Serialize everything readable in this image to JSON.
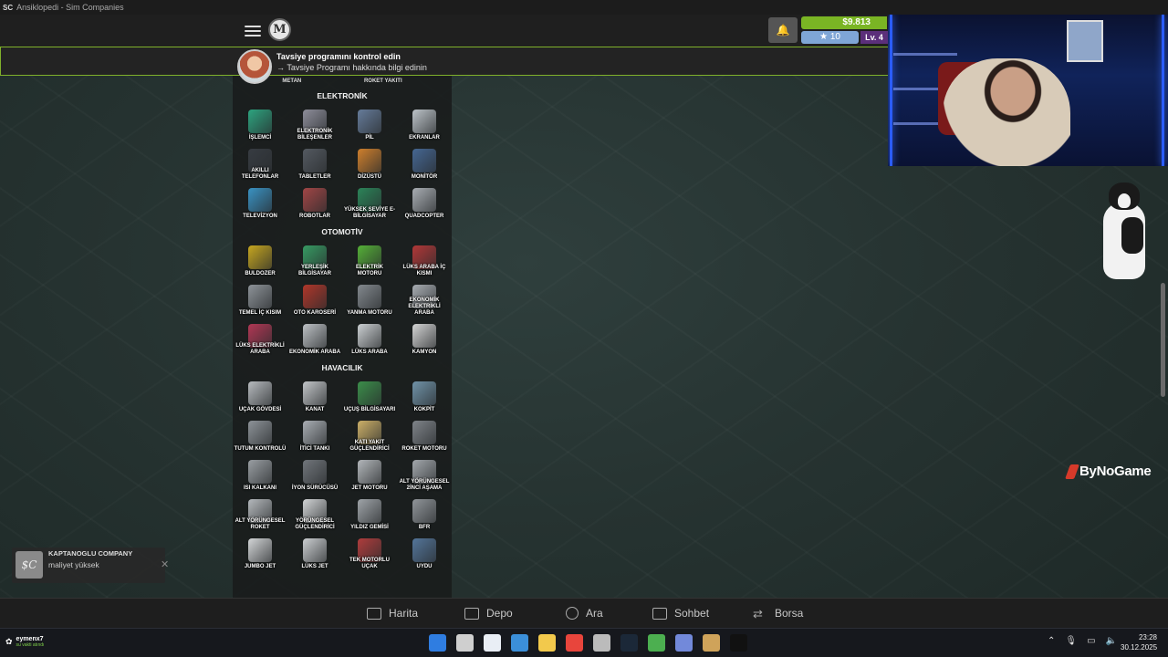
{
  "window": {
    "title": "Ansiklopedi - Sim Companies",
    "app_icon": "SC"
  },
  "topbar": {
    "logo_letter": "M",
    "money": "$9.813",
    "stars": "10",
    "level": "Lv. 4"
  },
  "banner": {
    "title": "Tavsiye programını kontrol edin",
    "link": "→ Tavsiye Programı hakkında bilgi edinin"
  },
  "encyclopedia": {
    "previous_row": [
      "METAN",
      "ROKET YAKITI"
    ],
    "categories": [
      {
        "title": "ELEKTRONİK",
        "items": [
          {
            "label": "İŞLEMCİ",
            "color": "#2fb38a"
          },
          {
            "label": "ELEKTRONİK BİLEŞENLER",
            "color": "#9a9aa8"
          },
          {
            "label": "PİL",
            "color": "#6e86a8"
          },
          {
            "label": "EKRANLAR",
            "color": "#cfd6dc"
          },
          {
            "label": "AKILLI TELEFONLAR",
            "color": "#3a3f46"
          },
          {
            "label": "TABLETLER",
            "color": "#5a6068"
          },
          {
            "label": "DİZÜSTÜ",
            "color": "#e38a2e"
          },
          {
            "label": "MONİTÖR",
            "color": "#4a6fa0"
          },
          {
            "label": "TELEVİZYON",
            "color": "#3d9fd6"
          },
          {
            "label": "ROBOTLAR",
            "color": "#b04a4a"
          },
          {
            "label": "YÜKSEK SEVİYE E-BİLGİSAYAR",
            "color": "#2d8f5f"
          },
          {
            "label": "QUADCOPTER",
            "color": "#b9bec4"
          }
        ]
      },
      {
        "title": "OTOMOTİV",
        "items": [
          {
            "label": "BULDOZER",
            "color": "#d9b520"
          },
          {
            "label": "YERLEŞİK BİLGİSAYAR",
            "color": "#3aa86a"
          },
          {
            "label": "ELEKTRİK MOTORU",
            "color": "#5bbf3a"
          },
          {
            "label": "LÜKS ARABA İÇ KISMI",
            "color": "#c23a3a"
          },
          {
            "label": "TEMEL İÇ KISIM",
            "color": "#9aa0a6"
          },
          {
            "label": "OTO KAROSERİ",
            "color": "#c0392b"
          },
          {
            "label": "YANMA MOTORU",
            "color": "#8e949a"
          },
          {
            "label": "EKONOMİK ELEKTRİKLİ ARABA",
            "color": "#b7bcc2"
          },
          {
            "label": "LÜKS ELEKTRİKLİ ARABA",
            "color": "#c23a5a"
          },
          {
            "label": "EKONOMİK ARABA",
            "color": "#cfd3d7"
          },
          {
            "label": "LÜKS ARABA",
            "color": "#dfe3e6"
          },
          {
            "label": "KAMYON",
            "color": "#e8e8e8"
          }
        ]
      },
      {
        "title": "HAVACILIK",
        "items": [
          {
            "label": "UÇAK GÖVDESİ",
            "color": "#c8ccd0"
          },
          {
            "label": "KANAT",
            "color": "#d5d8db"
          },
          {
            "label": "UÇUŞ BİLGİSAYARI",
            "color": "#3f9a4f"
          },
          {
            "label": "KOKPİT",
            "color": "#7aa0b8"
          },
          {
            "label": "TUTUM KONTROLÜ",
            "color": "#9aa0a6"
          },
          {
            "label": "İTİCİ TANKI",
            "color": "#b9bec4"
          },
          {
            "label": "KATI YAKIT GÜÇLENDİRİCİ",
            "color": "#e0c070"
          },
          {
            "label": "ROKET MOTORU",
            "color": "#8a8f95"
          },
          {
            "label": "ISI KALKANI",
            "color": "#a8adb2"
          },
          {
            "label": "İYON SÜRÜCÜSÜ",
            "color": "#7a7f85"
          },
          {
            "label": "JET MOTORU",
            "color": "#c4c8cc"
          },
          {
            "label": "ALT YÖRÜNGESEL 2İNCİ AŞAMA",
            "color": "#b2b7bc"
          },
          {
            "label": "ALT YÖRÜNGESEL ROKET",
            "color": "#c6cace"
          },
          {
            "label": "YÖRÜNGESEL GÜÇLENDİRİCİ",
            "color": "#e6e8ea"
          },
          {
            "label": "YILDIZ GEMİSİ",
            "color": "#aeb3b8"
          },
          {
            "label": "BFR",
            "color": "#9ea3a8"
          },
          {
            "label": "JUMBO JET",
            "color": "#e8eaec"
          },
          {
            "label": "LÜKS JET",
            "color": "#dfe2e5"
          },
          {
            "label": "TEK MOTORLU UÇAK",
            "color": "#c04040"
          },
          {
            "label": "UYDU",
            "color": "#5a7fa8"
          }
        ]
      }
    ]
  },
  "bottom_nav": [
    {
      "label": "Harita",
      "icon": "map-icon"
    },
    {
      "label": "Depo",
      "icon": "warehouse-icon"
    },
    {
      "label": "Ara",
      "icon": "search-icon"
    },
    {
      "label": "Sohbet",
      "icon": "chat-icon"
    },
    {
      "label": "Borsa",
      "icon": "exchange-icon"
    }
  ],
  "toast": {
    "icon": "$C",
    "company": "KAPTANOGLU COMPANY",
    "message": "maliyet yüksek",
    "close": "✕"
  },
  "overlay": {
    "brand": "ByNoGame"
  },
  "taskbar": {
    "user_name": "eymenx7",
    "user_status": "su vakti atındı",
    "time": "23:28",
    "date": "30.12.2025",
    "app_colors": [
      "#2f7de1",
      "#cfcfcf",
      "#e9eef5",
      "#3b8fd9",
      "#f2c94c",
      "#e8453c",
      "#bbbbbb",
      "#1b2838",
      "#4caf50",
      "#7289da",
      "#cfa35a",
      "#111111"
    ]
  }
}
